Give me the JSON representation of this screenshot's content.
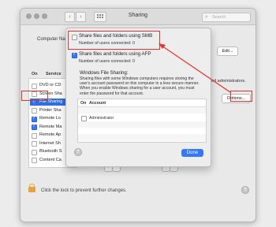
{
  "window": {
    "title": "Sharing",
    "search_placeholder": "Search"
  },
  "background": {
    "computer_name_label": "Computer Na",
    "edit_button": "Edit...",
    "admin_text_fragment": "ed administrators.",
    "options_button": "Options...",
    "services_header_on": "On",
    "services_header_service": "Service",
    "services": [
      {
        "label": "DVD or CD",
        "checked": false,
        "selected": false
      },
      {
        "label": "Screen Sha",
        "checked": false,
        "selected": false
      },
      {
        "label": "File Sharing",
        "checked": true,
        "selected": true
      },
      {
        "label": "Printer Sha",
        "checked": false,
        "selected": false
      },
      {
        "label": "Remote Lo",
        "checked": true,
        "selected": false
      },
      {
        "label": "Remote Ma",
        "checked": true,
        "selected": false
      },
      {
        "label": "Remote Ap",
        "checked": false,
        "selected": false
      },
      {
        "label": "Internet Sh",
        "checked": false,
        "selected": false
      },
      {
        "label": "Bluetooth S",
        "checked": false,
        "selected": false
      },
      {
        "label": "Content Ca",
        "checked": false,
        "selected": false
      }
    ],
    "plus_label": "+",
    "minus_label": "−",
    "lock_text": "Click the lock to prevent further changes.",
    "help_label": "?"
  },
  "sheet": {
    "smb_label": "Share files and folders using SMB",
    "smb_checked": false,
    "smb_users": "Number of users connected: 0",
    "afp_label": "Share files and folders using AFP",
    "afp_checked": true,
    "afp_users": "Number of users connected: 0",
    "windows_title": "Windows File Sharing:",
    "windows_desc": "Sharing files with some Windows computers requires storing the user's account password on this computer in a less secure manner. When you enable Windows sharing for a user account, you must enter the password for that account.",
    "table_header_on": "On",
    "table_header_account": "Account",
    "accounts": [
      {
        "label": "Administrator",
        "checked": false
      }
    ],
    "help_label": "?",
    "done_label": "Done"
  },
  "colors": {
    "accent": "#3478f6",
    "annotation": "#e0332e",
    "lock": "#e8a23a"
  }
}
